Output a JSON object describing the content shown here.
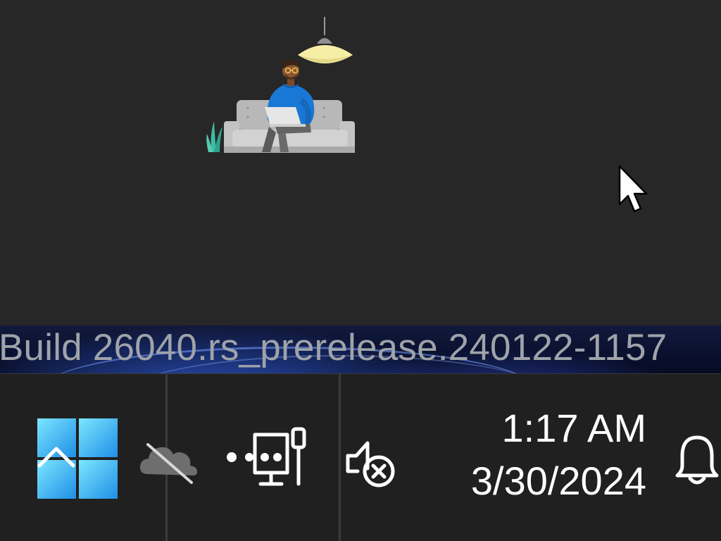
{
  "watermark": {
    "text": "Build 26040.rs_prerelease.240122-1157"
  },
  "desktop": {
    "illustration_icon": "person-on-couch-with-laptop",
    "pointer_icon": "mouse-pointer"
  },
  "taskbar": {
    "start_icon": "windows-logo",
    "overflow_icon": "chevron-up",
    "onedrive_icon": "onedrive-cloud-offline",
    "network_icon": "network-ethernet-disconnected",
    "volume_icon": "speaker-muted",
    "clock": {
      "time": "1:17 AM",
      "date": "3/30/2024"
    },
    "notification_icon": "bell"
  },
  "colors": {
    "desktop_background": "#272727",
    "taskbar_background": "#202020",
    "start_tile_light": "#7de6ff",
    "start_tile_dark": "#1e8fe6",
    "watermark_text": "#9fa3aa"
  }
}
